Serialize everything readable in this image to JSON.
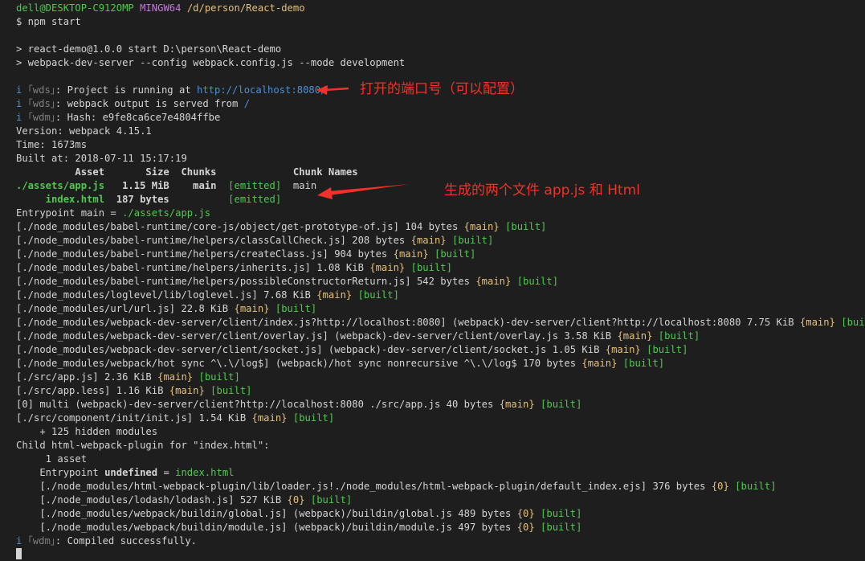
{
  "prompt": {
    "user_host": "dell@DESKTOP-C912OMP",
    "shell": "MINGW64",
    "path": "/d/person/React-demo",
    "command": "$ npm start"
  },
  "npm": {
    "line1": "> react-demo@1.0.0 start D:\\person\\React-demo",
    "line2": "> webpack-dev-server --config webpack.config.js --mode development"
  },
  "wds": {
    "i": "i",
    "tag_wds": "｢wds｣",
    "tag_wdm": "｢wdm｣",
    "running_prefix": ": Project is running at ",
    "running_url": "http://localhost:8080/",
    "output_prefix": ": webpack output is served from ",
    "output_path": "/",
    "hash": ": Hash: e9fe8ca6ce7e4804ffbe",
    "compiled": ": Compiled successfully."
  },
  "stats": {
    "version": "Version: webpack 4.15.1",
    "time": "Time: 1673ms",
    "built_at": "Built at: 2018-07-11 15:17:19"
  },
  "assets_table": {
    "header": "          Asset       Size  Chunks             Chunk Names",
    "row1_name": "./assets/app.js",
    "row1_size": "   1.15 MiB    main  ",
    "row1_status": "[emitted]",
    "row1_chunk": "  main",
    "row2_name": "     index.html",
    "row2_size": "  187 bytes          ",
    "row2_status": "[emitted]"
  },
  "entrypoint": {
    "label": "Entrypoint main = ",
    "value": "./assets/app.js"
  },
  "modules": [
    {
      "path": "[./node_modules/babel-runtime/core-js/object/get-prototype-of.js] 104 bytes ",
      "chunk": "{main}",
      "built": " [built]"
    },
    {
      "path": "[./node_modules/babel-runtime/helpers/classCallCheck.js] 208 bytes ",
      "chunk": "{main}",
      "built": " [built]"
    },
    {
      "path": "[./node_modules/babel-runtime/helpers/createClass.js] 904 bytes ",
      "chunk": "{main}",
      "built": " [built]"
    },
    {
      "path": "[./node_modules/babel-runtime/helpers/inherits.js] 1.08 KiB ",
      "chunk": "{main}",
      "built": " [built]"
    },
    {
      "path": "[./node_modules/babel-runtime/helpers/possibleConstructorReturn.js] 542 bytes ",
      "chunk": "{main}",
      "built": " [built]"
    },
    {
      "path": "[./node_modules/loglevel/lib/loglevel.js] 7.68 KiB ",
      "chunk": "{main}",
      "built": " [built]"
    },
    {
      "path": "[./node_modules/url/url.js] 22.8 KiB ",
      "chunk": "{main}",
      "built": " [built]"
    },
    {
      "path": "[./node_modules/webpack-dev-server/client/index.js?http://localhost:8080] (webpack)-dev-server/client?http://localhost:8080 7.75 KiB ",
      "chunk": "{main}",
      "built": " [built]"
    },
    {
      "path": "[./node_modules/webpack-dev-server/client/overlay.js] (webpack)-dev-server/client/overlay.js 3.58 KiB ",
      "chunk": "{main}",
      "built": " [built]"
    },
    {
      "path": "[./node_modules/webpack-dev-server/client/socket.js] (webpack)-dev-server/client/socket.js 1.05 KiB ",
      "chunk": "{main}",
      "built": " [built]"
    },
    {
      "path": "[./node_modules/webpack/hot sync ^\\.\\/log$] (webpack)/hot sync nonrecursive ^\\.\\/log$ 170 bytes ",
      "chunk": "{main}",
      "built": " [built]"
    },
    {
      "path": "[./src/app.js] 2.36 KiB ",
      "chunk": "{main}",
      "built": " [built]"
    },
    {
      "path": "[./src/app.less] 1.16 KiB ",
      "chunk": "{main}",
      "built": " [built]"
    },
    {
      "path": "[0] multi (webpack)-dev-server/client?http://localhost:8080 ./src/app.js 40 bytes ",
      "chunk": "{main}",
      "built": " [built]"
    },
    {
      "path": "[./src/component/init/init.js] 1.54 KiB ",
      "chunk": "{main}",
      "built": " [built]"
    }
  ],
  "hidden_modules": "    + 125 hidden modules",
  "child": {
    "title": "Child html-webpack-plugin for \"index.html\":",
    "asset_count": "     1 asset",
    "entry_label": "    Entrypoint ",
    "entry_undefined": "undefined",
    "entry_eq": " = ",
    "entry_value": "index.html",
    "modules": [
      {
        "path": "    [./node_modules/html-webpack-plugin/lib/loader.js!./node_modules/html-webpack-plugin/default_index.ejs] 376 bytes ",
        "chunk": "{0}",
        "built": " [built]"
      },
      {
        "path": "    [./node_modules/lodash/lodash.js] 527 KiB ",
        "chunk": "{0}",
        "built": " [built]"
      },
      {
        "path": "    [./node_modules/webpack/buildin/global.js] (webpack)/buildin/global.js 489 bytes ",
        "chunk": "{0}",
        "built": " [built]"
      },
      {
        "path": "    [./node_modules/webpack/buildin/module.js] (webpack)/buildin/module.js 497 bytes ",
        "chunk": "{0}",
        "built": " [built]"
      }
    ]
  },
  "annotations": {
    "port_note": "打开的端口号（可以配置）",
    "files_note": "生成的两个文件  app.js 和 Html"
  },
  "colors": {
    "background": "#1e1e1e",
    "text": "#d4d4d4",
    "green": "#4ec94e",
    "purple": "#c27bd6",
    "yellow": "#e5c07b",
    "cyan": "#3fb5c9",
    "blue": "#4d8fd6",
    "annotation_red": "#f0322a"
  }
}
